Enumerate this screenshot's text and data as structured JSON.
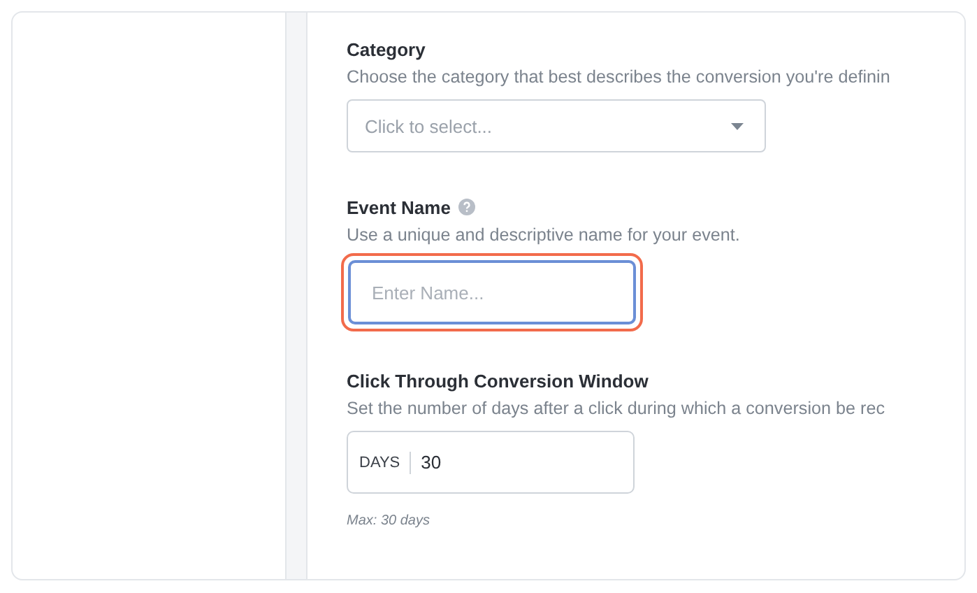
{
  "fields": [
    {
      "kind": "select",
      "label": "Category",
      "help": false,
      "description": "Choose the category that best describes the conversion you're definin",
      "placeholder": "Click to select...",
      "highlighted": false
    },
    {
      "kind": "text",
      "label": "Event Name",
      "help": true,
      "description": "Use a unique and descriptive name for your event.",
      "placeholder": "Enter Name...",
      "highlighted": true
    },
    {
      "kind": "number",
      "label": "Click Through Conversion Window",
      "help": false,
      "description": "Set the number of days after a click during which a conversion be rec",
      "prefix": "DAYS",
      "value": "30",
      "note": "Max: 30 days",
      "highlighted": false
    }
  ]
}
